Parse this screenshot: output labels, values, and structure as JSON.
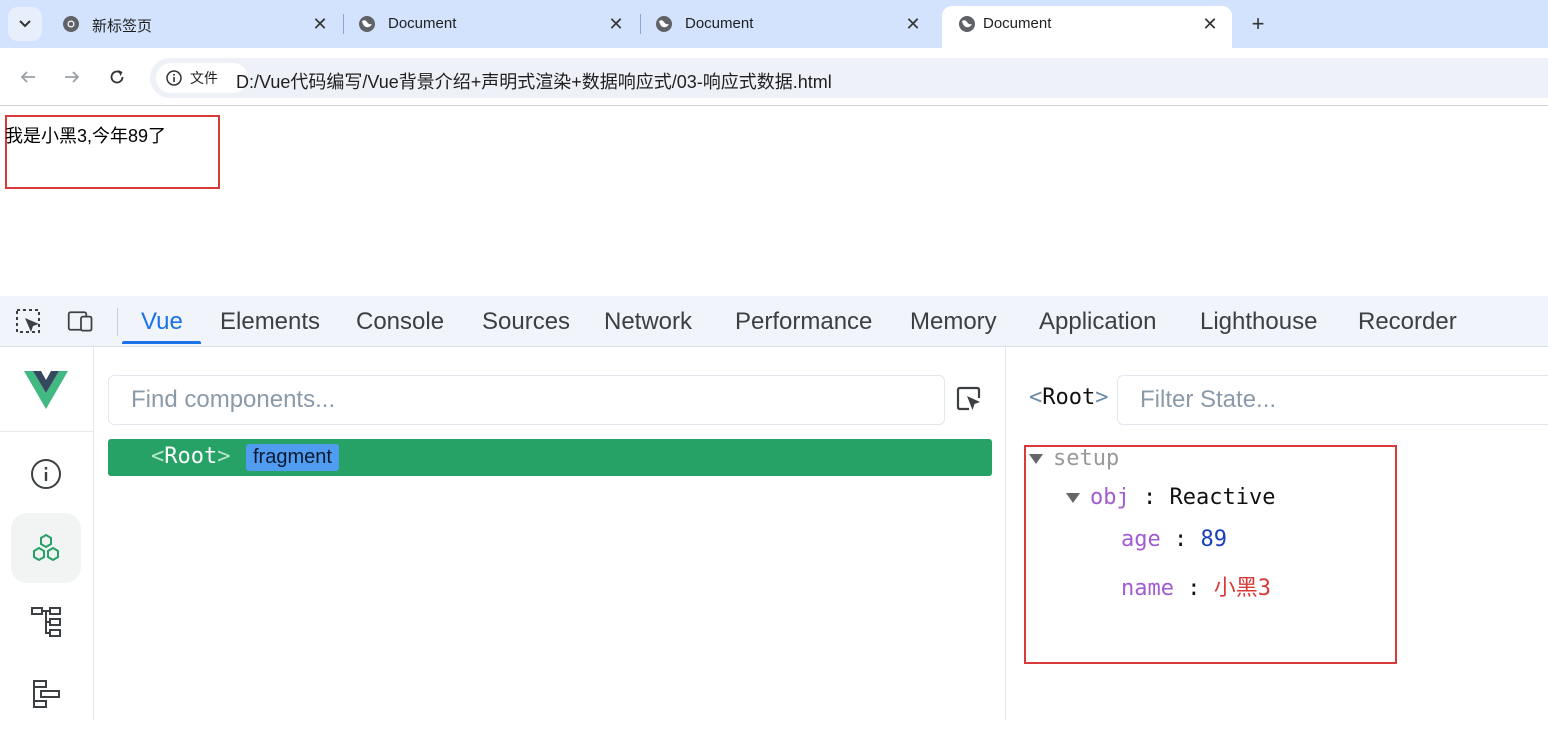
{
  "browser": {
    "tabs": [
      {
        "label": "新标签页",
        "icon": "chrome-icon",
        "active": false
      },
      {
        "label": "Document",
        "icon": "globe-icon",
        "active": false
      },
      {
        "label": "Document",
        "icon": "globe-icon",
        "active": false
      },
      {
        "label": "Document",
        "icon": "globe-icon",
        "active": true
      }
    ],
    "new_tab_label": "+",
    "close_label": "✕",
    "address": {
      "chip_label": "文件",
      "url": "D:/Vue代码编写/Vue背景介绍+声明式渲染+数据响应式/03-响应式数据.html"
    }
  },
  "page": {
    "app_text": "我是小黑3,今年89了"
  },
  "devtools": {
    "tabs": [
      "Vue",
      "Elements",
      "Console",
      "Sources",
      "Network",
      "Performance",
      "Memory",
      "Application",
      "Lighthouse",
      "Recorder"
    ],
    "active_tab": "Vue",
    "vue": {
      "find_placeholder": "Find components...",
      "filter_placeholder": "Filter State...",
      "root_component": {
        "open": "<",
        "name": "Root",
        "close": ">",
        "badge": "fragment"
      },
      "selected": {
        "open": "<",
        "name": "Root",
        "close": ">"
      },
      "state": {
        "section": "setup",
        "obj": {
          "key": "obj",
          "type": "Reactive"
        },
        "fields": [
          {
            "key": "age",
            "value": "89",
            "kind": "number"
          },
          {
            "key": "name",
            "value": "小黑3",
            "kind": "string"
          }
        ]
      }
    }
  },
  "colors": {
    "tabstrip": "#d3e3fd",
    "vue_green": "#27a267",
    "highlight_red": "#d83a3a",
    "devtools_active": "#1a73e8"
  }
}
